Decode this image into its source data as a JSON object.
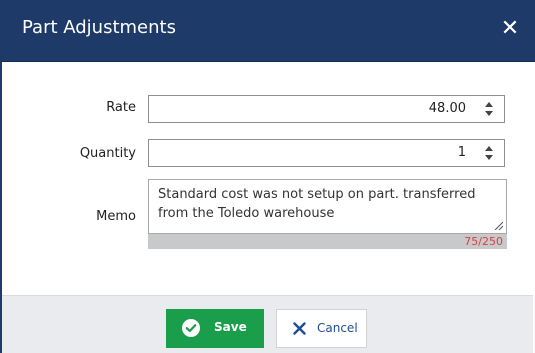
{
  "dialog": {
    "title": "Part Adjustments",
    "close_icon": "close-icon"
  },
  "form": {
    "rate": {
      "label": "Rate",
      "value": "48.00"
    },
    "quantity": {
      "label": "Quantity",
      "value": "1"
    },
    "memo": {
      "label": "Memo",
      "value": "Standard cost was not setup on part. transferred from the Toledo warehouse",
      "counter": "75/250"
    }
  },
  "footer": {
    "save_label": "Save",
    "save_icon": "check-circle-icon",
    "cancel_label": "Cancel",
    "cancel_icon": "x-icon"
  },
  "colors": {
    "titlebar": "#1e3a68",
    "save": "#1b9e4b",
    "cancel_text": "#1d4f91",
    "counter_text": "#d94040"
  }
}
